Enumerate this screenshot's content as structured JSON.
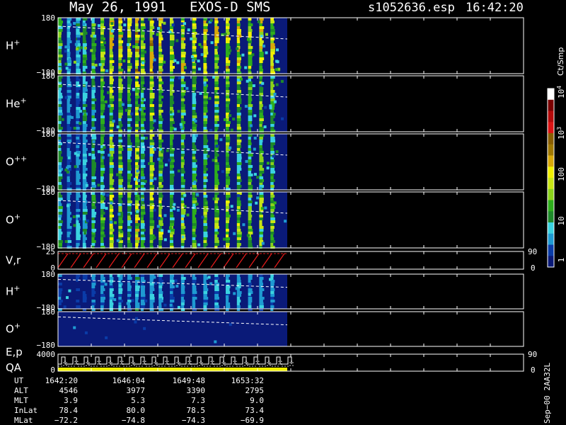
{
  "header": {
    "date": "May 26, 1991",
    "instrument": "EXOS-D SMS",
    "file": "s1052636.esp",
    "time": "16:42:20"
  },
  "colorbar": {
    "unit": "Ct/Smp",
    "ticks": [
      "1",
      "10",
      "100",
      "10",
      "10"
    ],
    "tick_exps": [
      "",
      "",
      "",
      "3",
      "4"
    ],
    "colors": [
      "#0a1a78",
      "#0a3ca8",
      "#1e9ad2",
      "#3ad2e0",
      "#1e8a2a",
      "#2eae1c",
      "#8ad21a",
      "#c8e614",
      "#f0f000",
      "#d8a808",
      "#a07800",
      "#8a5e00",
      "#dc1414",
      "#b40a0a",
      "#7a0000",
      "#ffffff"
    ]
  },
  "chart_data": {
    "type": "heatmap",
    "panels": [
      {
        "label": "H",
        "sup": "+",
        "ymax": "180",
        "ymin": "−180",
        "intensity": 1.0
      },
      {
        "label": "He",
        "sup": "+",
        "ymax": "180",
        "ymin": "−180",
        "intensity": 0.75
      },
      {
        "label": "O",
        "sup": "++",
        "ymax": "180",
        "ymin": "−180",
        "intensity": 0.7
      },
      {
        "label": "O",
        "sup": "+",
        "ymax": "180",
        "ymin": "−180",
        "intensity": 0.8
      },
      {
        "label": "V,r",
        "sup": "",
        "ymax": "25",
        "ymin": "0",
        "right_top": "90",
        "right_bottom": "0"
      },
      {
        "label": "H",
        "sup": "+",
        "ymax": "180",
        "ymin": "−180",
        "intensity": 0.35
      },
      {
        "label": "O",
        "sup": "+",
        "ymax": "180",
        "ymin": "−180",
        "intensity": 0.1
      },
      {
        "label": "E,p",
        "label2": "QA",
        "sup": "",
        "ymax": "4000",
        "ymin": "0",
        "right_top": "90",
        "right_bottom": "0"
      }
    ],
    "bands": [
      {
        "x": 0.0,
        "s": 0.55
      },
      {
        "x": 0.04,
        "s": 0.3
      },
      {
        "x": 0.08,
        "s": 0.35
      },
      {
        "x": 0.11,
        "s": 0.45
      },
      {
        "x": 0.15,
        "s": 0.55
      },
      {
        "x": 0.19,
        "s": 0.65
      },
      {
        "x": 0.23,
        "s": 0.85
      },
      {
        "x": 0.27,
        "s": 0.8
      },
      {
        "x": 0.31,
        "s": 0.7
      },
      {
        "x": 0.345,
        "s": 0.95
      },
      {
        "x": 0.37,
        "s": 0.65
      },
      {
        "x": 0.41,
        "s": 0.9
      },
      {
        "x": 0.45,
        "s": 0.85
      },
      {
        "x": 0.5,
        "s": 0.7
      },
      {
        "x": 0.55,
        "s": 0.75
      },
      {
        "x": 0.6,
        "s": 0.7
      },
      {
        "x": 0.65,
        "s": 0.75
      },
      {
        "x": 0.7,
        "s": 0.8
      },
      {
        "x": 0.75,
        "s": 0.85
      },
      {
        "x": 0.8,
        "s": 0.85
      },
      {
        "x": 0.85,
        "s": 0.7
      },
      {
        "x": 0.9,
        "s": 0.8
      },
      {
        "x": 0.95,
        "s": 0.75
      }
    ],
    "ephemeris": {
      "row_labels": [
        "UT",
        "ALT",
        "MLT",
        "InLat",
        "MLat"
      ],
      "columns": [
        [
          "1642:20",
          "4546",
          "3.9",
          "78.4",
          "−72.2"
        ],
        [
          "1646:04",
          "3977",
          "5.3",
          "80.0",
          "−74.8"
        ],
        [
          "1649:48",
          "3390",
          "7.3",
          "78.5",
          "−74.3"
        ],
        [
          "1653:32",
          "2795",
          "9.0",
          "73.4",
          "−69.9"
        ]
      ]
    }
  },
  "footer_vertical": "Sep−00  2AA32L"
}
